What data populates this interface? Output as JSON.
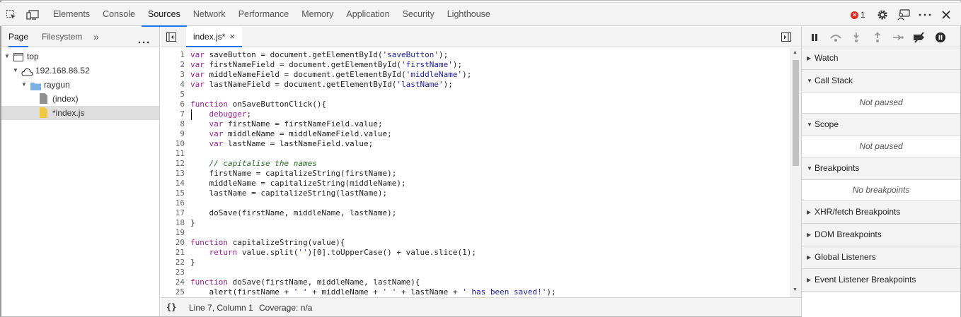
{
  "toolbar": {
    "tabs": [
      "Elements",
      "Console",
      "Sources",
      "Network",
      "Performance",
      "Memory",
      "Application",
      "Security",
      "Lighthouse"
    ],
    "active_tab": "Sources",
    "error_count": "1"
  },
  "navigator": {
    "tabs": [
      "Page",
      "Filesystem"
    ],
    "more_label": "»",
    "tree": {
      "top": "top",
      "host": "192.168.86.52",
      "folder": "raygun",
      "file_index": "(index)",
      "file_js": "*index.js"
    }
  },
  "editor": {
    "file_tab": "index.js*",
    "close_glyph": "×",
    "lines": [
      "var saveButton = document.getElementById('saveButton');",
      "var firstNameField = document.getElementById('firstName');",
      "var middleNameField = document.getElementById('middleName');",
      "var lastNameField = document.getElementById('lastName');",
      "",
      "function onSaveButtonClick(){",
      "    debugger;",
      "    var firstName = firstNameField.value;",
      "    var middleName = middleNameField.value;",
      "    var lastName = lastNameField.value;",
      "",
      "    // capitalise the names",
      "    firstName = capitalizeString(firstName);",
      "    middleName = capitalizeString(middleName);",
      "    lastName = capitalizeString(lastName);",
      "",
      "    doSave(firstName, middleName, lastName);",
      "}",
      "",
      "function capitalizeString(value){",
      "    return value.split('')[0].toUpperCase() + value.slice(1);",
      "}",
      "",
      "function doSave(firstName, middleName, lastName){",
      "    alert(firstName + ' ' + middleName + ' ' + lastName + ' has been saved!');"
    ],
    "status": {
      "braces": "{}",
      "position": "Line 7, Column 1",
      "coverage": "Coverage: n/a"
    }
  },
  "debugger": {
    "sections": [
      {
        "title": "Watch",
        "expanded": false
      },
      {
        "title": "Call Stack",
        "expanded": true,
        "body": "Not paused"
      },
      {
        "title": "Scope",
        "expanded": true,
        "body": "Not paused"
      },
      {
        "title": "Breakpoints",
        "expanded": true,
        "body": "No breakpoints"
      },
      {
        "title": "XHR/fetch Breakpoints",
        "expanded": false
      },
      {
        "title": "DOM Breakpoints",
        "expanded": false
      },
      {
        "title": "Global Listeners",
        "expanded": false
      },
      {
        "title": "Event Listener Breakpoints",
        "expanded": false
      }
    ]
  },
  "colors": {
    "accent": "#1a73e8",
    "keyword": "#a21e9b",
    "string": "#1a1aa6",
    "comment": "#236e25",
    "error": "#d93025"
  }
}
